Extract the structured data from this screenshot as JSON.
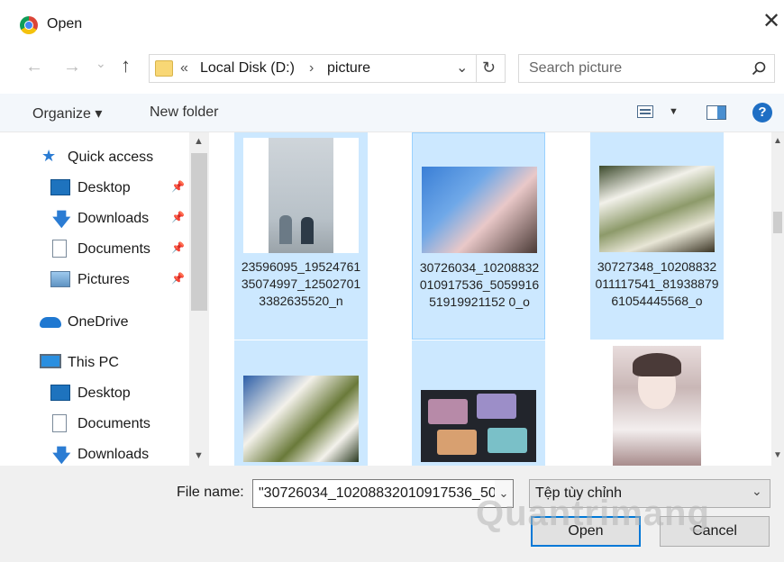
{
  "window": {
    "title": "Open"
  },
  "nav": {
    "back": "←",
    "forward": "→",
    "recent": "⌄",
    "up": "↑"
  },
  "address": {
    "prefix": "«",
    "crumb1": "Local Disk (D:)",
    "sep": "›",
    "crumb2": "picture",
    "dropdown": "⌄",
    "refresh": "↻"
  },
  "search": {
    "placeholder": "Search picture"
  },
  "toolbar": {
    "organize": "Organize ▾",
    "new_folder": "New folder"
  },
  "sidebar": {
    "quick_access": "Quick access",
    "qa_items": [
      {
        "label": "Desktop"
      },
      {
        "label": "Downloads"
      },
      {
        "label": "Documents"
      },
      {
        "label": "Pictures"
      }
    ],
    "onedrive": "OneDrive",
    "this_pc": "This PC",
    "pc_items": [
      {
        "label": "Desktop"
      },
      {
        "label": "Documents"
      },
      {
        "label": "Downloads"
      }
    ]
  },
  "files": [
    {
      "name": "23596095_1952476135074997_125027013382635520_n"
    },
    {
      "name": "30726034_10208832010917536_505991651919921152 0_o"
    },
    {
      "name": "30727348_10208832011117541_8193887961054445568_o"
    }
  ],
  "bottom": {
    "file_name_label": "File name:",
    "file_name_value": "\"30726034_10208832010917536_50",
    "file_type": "Tệp tùy chỉnh",
    "open": "Open",
    "cancel": "Cancel"
  },
  "watermark": "Quantrimang",
  "colors": {
    "selection": "#cce8ff",
    "accent": "#0078d7"
  }
}
